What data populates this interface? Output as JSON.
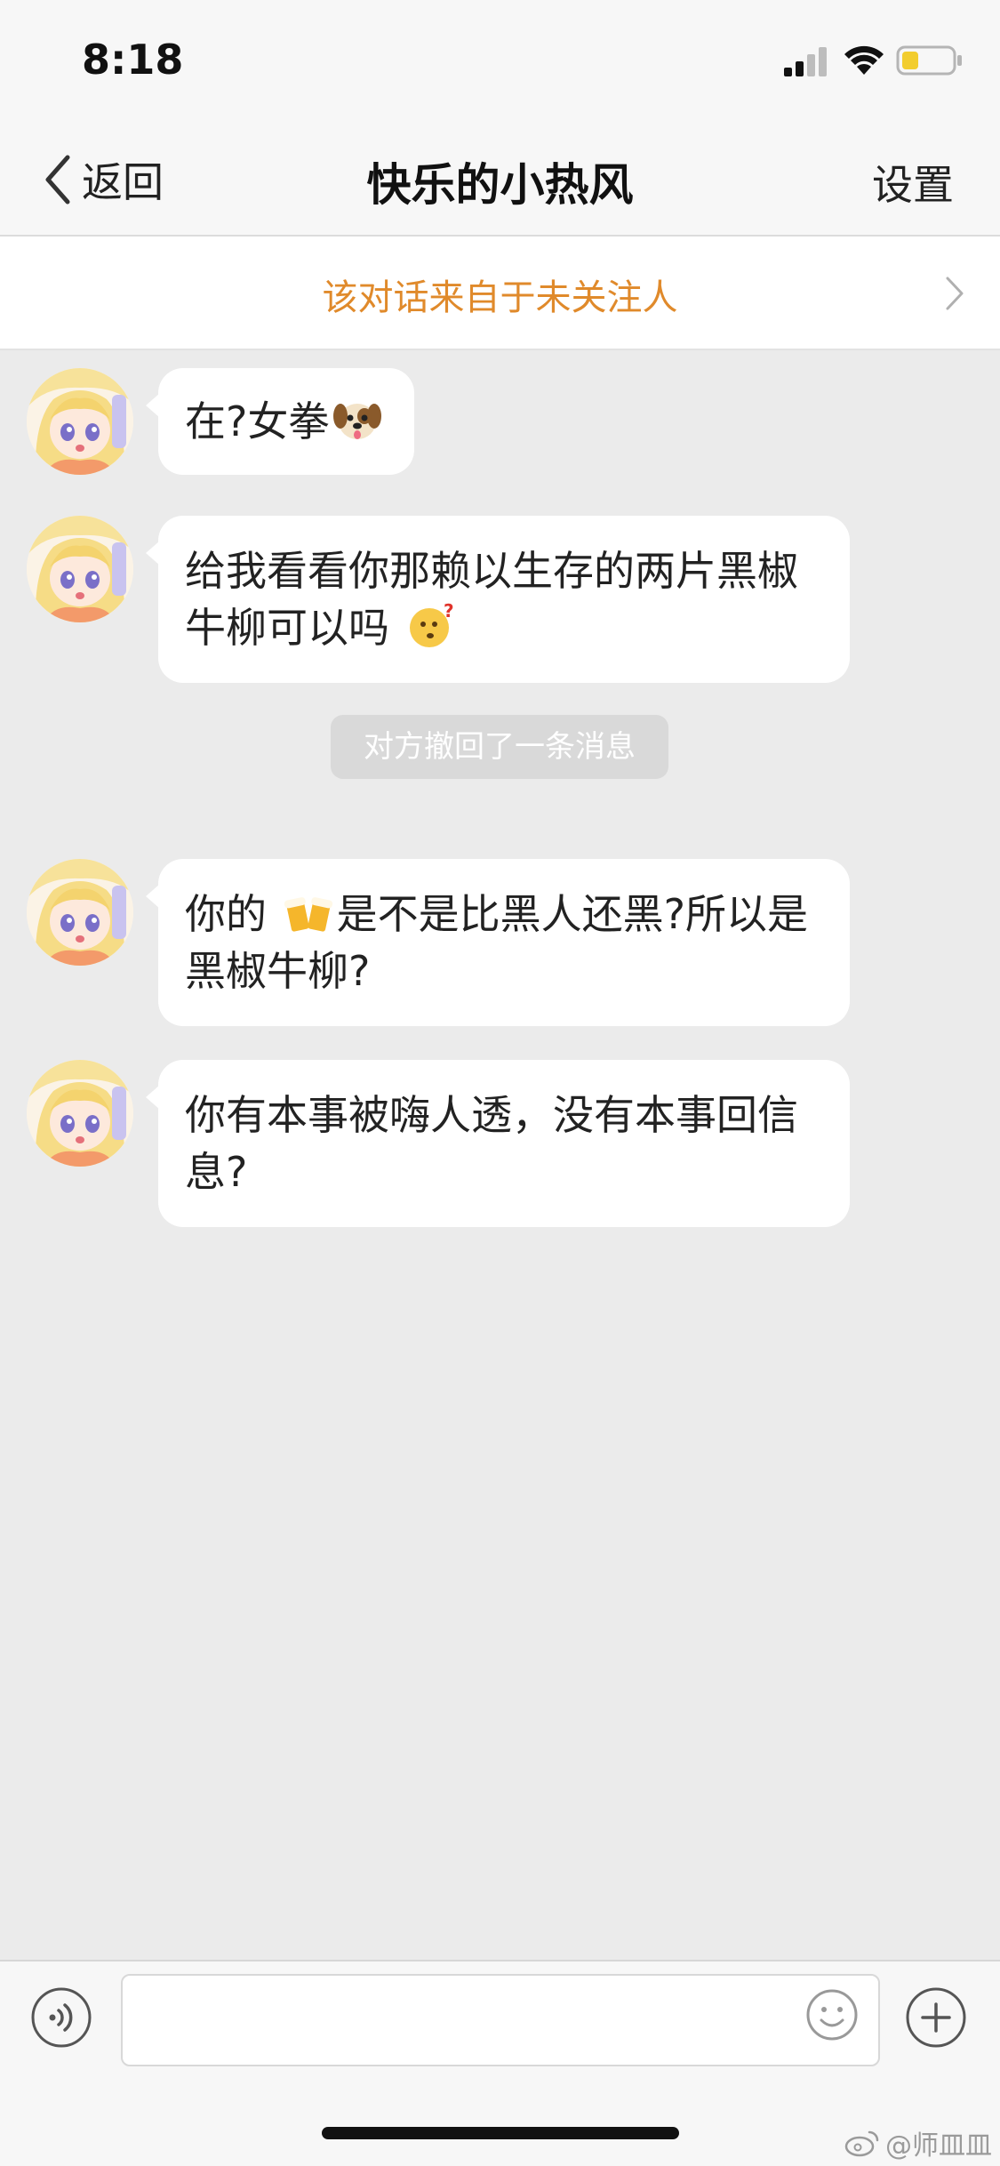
{
  "status_bar": {
    "time": "8:18",
    "icons": [
      "signal-icon",
      "wifi-icon",
      "battery-icon"
    ]
  },
  "nav": {
    "back_label": "返回",
    "title": "快乐的小热风",
    "settings_label": "设置"
  },
  "notice": {
    "text": "该对话来自于未关注人"
  },
  "messages": [
    {
      "parts": [
        "在?女拳",
        ""
      ],
      "emoji": "dog-face-emoji"
    },
    {
      "parts": [
        "给我看看你那赖以生存的两片黑椒牛柳可以吗 ",
        ""
      ],
      "emoji": "thinking-face-emoji"
    },
    {
      "parts": [
        "你的 ",
        "是不是比黑人还黑?所以是黑椒牛柳?"
      ],
      "emoji": "beer-mugs-emoji"
    },
    {
      "parts": [
        "你有本事被嗨人透，没有本事回信息?",
        ""
      ],
      "emoji": ""
    }
  ],
  "system_notice": "对方撤回了一条消息",
  "input": {
    "value": "",
    "placeholder": ""
  },
  "watermark": "@师皿皿",
  "colors": {
    "notice_text": "#e08a2b",
    "chat_background": "#ebebeb",
    "bubble": "#ffffff"
  }
}
